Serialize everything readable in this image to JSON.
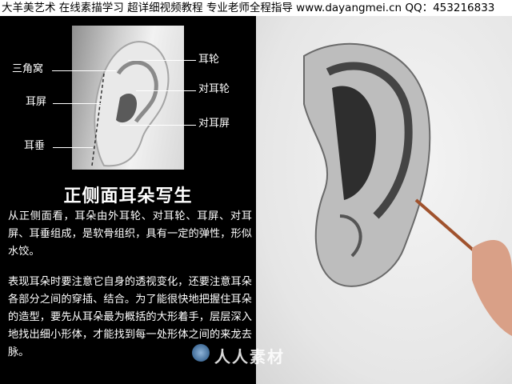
{
  "header": {
    "text": "大羊美艺术 在线素描学习 超详细视频教程 专业老师全程指导 www.dayangmei.cn QQ：453216833"
  },
  "diagram": {
    "labels": {
      "sanjiaowo": "三角窝",
      "erlun": "耳轮",
      "duierlun": "对耳轮",
      "erping": "耳屏",
      "duierping": "对耳屏",
      "erchui": "耳垂"
    }
  },
  "title": "正侧面耳朵写生",
  "paragraphs": [
    "从正侧面看，耳朵由外耳轮、对耳轮、耳屏、对耳屏、耳垂组成，是软骨组织，具有一定的弹性，形似水饺。",
    "表现耳朵时要注意它自身的透视变化，还要注意耳朵各部分之间的穿插、结合。为了能很快地把握住耳朵的造型，要先从耳朵最为概括的大形着手，层层深入地找出细小形体，才能找到每一处形体之间的来龙去脉。"
  ],
  "watermark": "人人素材"
}
